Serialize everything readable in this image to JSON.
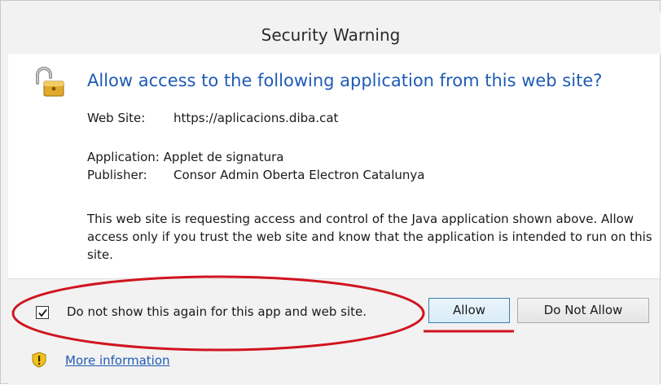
{
  "dialog": {
    "title": "Security Warning",
    "headline": "Allow access to the following application from this web site?",
    "website_label": "Web Site:",
    "website_value": "https://aplicacions.diba.cat",
    "application_label": "Application:",
    "application_value": "Applet de signatura",
    "publisher_label": "Publisher:",
    "publisher_value": "Consor Admin Oberta Electron Catalunya",
    "description": "This web site is requesting access and control of the Java application shown above. Allow access only if you trust the web site and know that the application is intended to run on this site.",
    "checkbox_label": "Do not show this again for this app and web site.",
    "checkbox_checked": true,
    "allow_label": "Allow",
    "deny_label": "Do Not Allow",
    "more_info_label": "More information"
  },
  "icons": {
    "lock": "unlocked-padlock-icon",
    "warning": "warning-shield-icon",
    "check": "checkmark-icon"
  },
  "colors": {
    "headline": "#1f5bb5",
    "link": "#1f5bb5",
    "annotation": "#d0141f",
    "window_background": "#f2f2f2",
    "content_background": "#ffffff"
  }
}
